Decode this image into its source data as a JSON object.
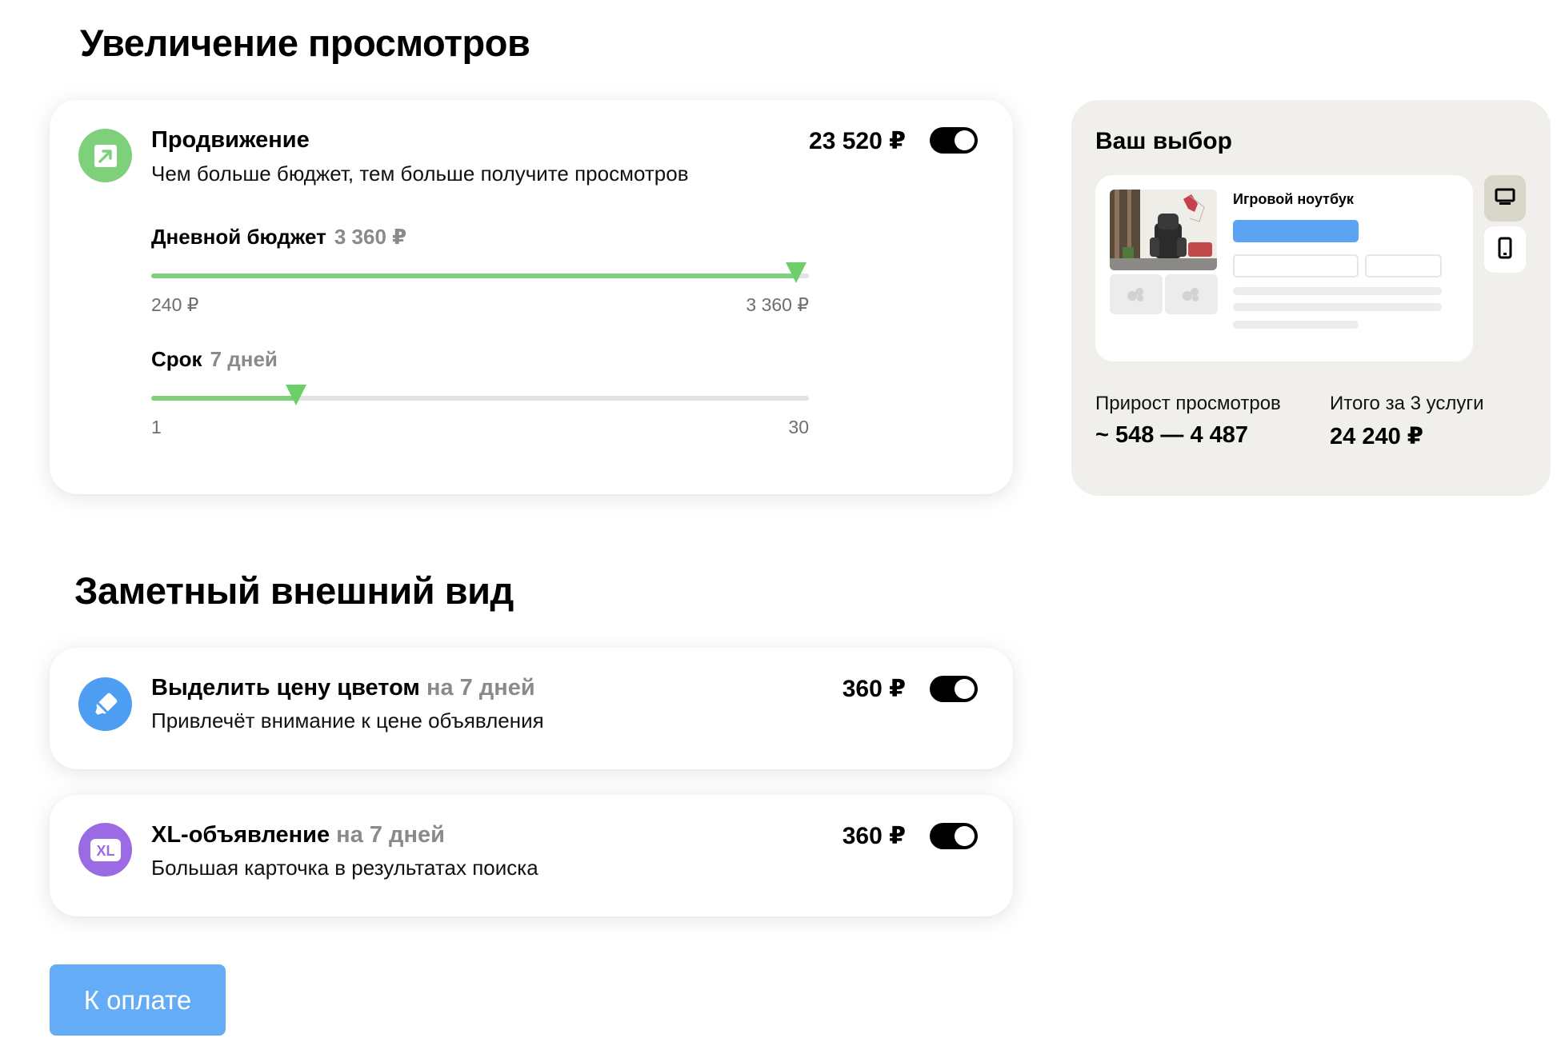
{
  "sections": {
    "views_title": "Увеличение просмотров",
    "appearance_title": "Заметный внешний вид"
  },
  "promotion": {
    "title": "Продвижение",
    "description": "Чем больше бюджет, тем больше получите просмотров",
    "price": "23 520 ₽",
    "enabled": true,
    "icon": "arrow-up-right-icon",
    "daily_budget": {
      "label": "Дневной бюджет",
      "value": "3 360 ₽",
      "min": "240 ₽",
      "max": "3 360 ₽",
      "fraction": 0.98
    },
    "term": {
      "label": "Срок",
      "value": "7 дней",
      "min": "1",
      "max": "30",
      "fraction": 0.22
    }
  },
  "highlight_price": {
    "title": "Выделить цену цветом",
    "duration": "на 7 дней",
    "description": "Привлечёт внимание к цене объявления",
    "price": "360 ₽",
    "enabled": true,
    "icon": "marker-icon"
  },
  "xl_listing": {
    "title": "XL-объявление",
    "duration": "на 7 дней",
    "description": "Большая карточка в результатах поиска",
    "price": "360 ₽",
    "enabled": true,
    "icon": "xl-icon",
    "icon_text": "XL"
  },
  "your_choice": {
    "title": "Ваш выбор",
    "preview_item_name": "Игровой ноутбук",
    "views_growth_label": "Прирост просмотров",
    "views_growth_value": "~ 548 — 4 487",
    "total_label": "Итого за 3 услуги",
    "total_value": "24 240 ₽"
  },
  "checkout": {
    "button_label": "К оплате"
  },
  "colors": {
    "green": "#7ed17a",
    "blue": "#4d9ef2",
    "purple": "#9b6be3",
    "pay_button": "#64acf5",
    "panel": "#f0efeb"
  }
}
